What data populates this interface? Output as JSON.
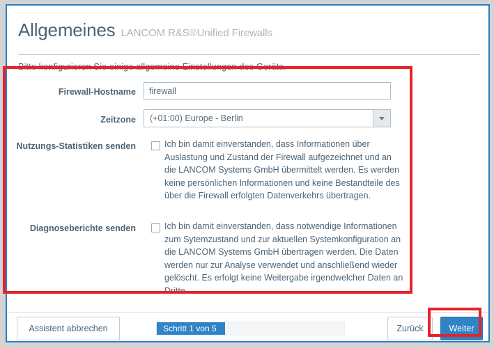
{
  "window": {
    "accent_color": "#2b7cc4",
    "annotation_color": "#e8222a"
  },
  "header": {
    "title": "Allgemeines",
    "subtitle": "LANCOM R&S®Unified Firewalls",
    "intro": "Bitte konfigurieren Sie einige allgemeine Einstellungen des Geräts."
  },
  "form": {
    "hostname": {
      "label": "Firewall-Hostname",
      "value": "firewall",
      "placeholder": ""
    },
    "timezone": {
      "label": "Zeitzone",
      "value": "(+01:00) Europe - Berlin",
      "dropdown_icon": "chevron-down-icon"
    },
    "usage_statistics": {
      "label": "Nutzungs-Statistiken senden",
      "checked": false,
      "text": "Ich bin damit einverstanden, dass Informationen über Auslastung und Zustand der Firewall aufgezeichnet und an die LANCOM Systems GmbH übermittelt werden. Es werden keine persönlichen Informationen und keine Bestandteile des über die Firewall erfolgten Datenverkehrs übertragen."
    },
    "diagnostic_reports": {
      "label": "Diagnoseberichte senden",
      "checked": false,
      "text": "Ich bin damit einverstanden, dass notwendige Informationen zum Sytemzustand und zur aktuellen Systemkonfiguration an die LANCOM Systems GmbH übertragen werden. Die Daten werden nur zur Analyse verwendet und anschließend wieder gelöscht. Es erfolgt keine Weitergabe irgendwelcher Daten an Dritte."
    }
  },
  "footer": {
    "cancel_label": "Assistent abbrechen",
    "back_label": "Zurück",
    "next_label": "Weiter",
    "progress_label": "Schritt 1 von 5",
    "current_step": 1,
    "total_steps": 5,
    "progress_color": "#2e84c6"
  }
}
